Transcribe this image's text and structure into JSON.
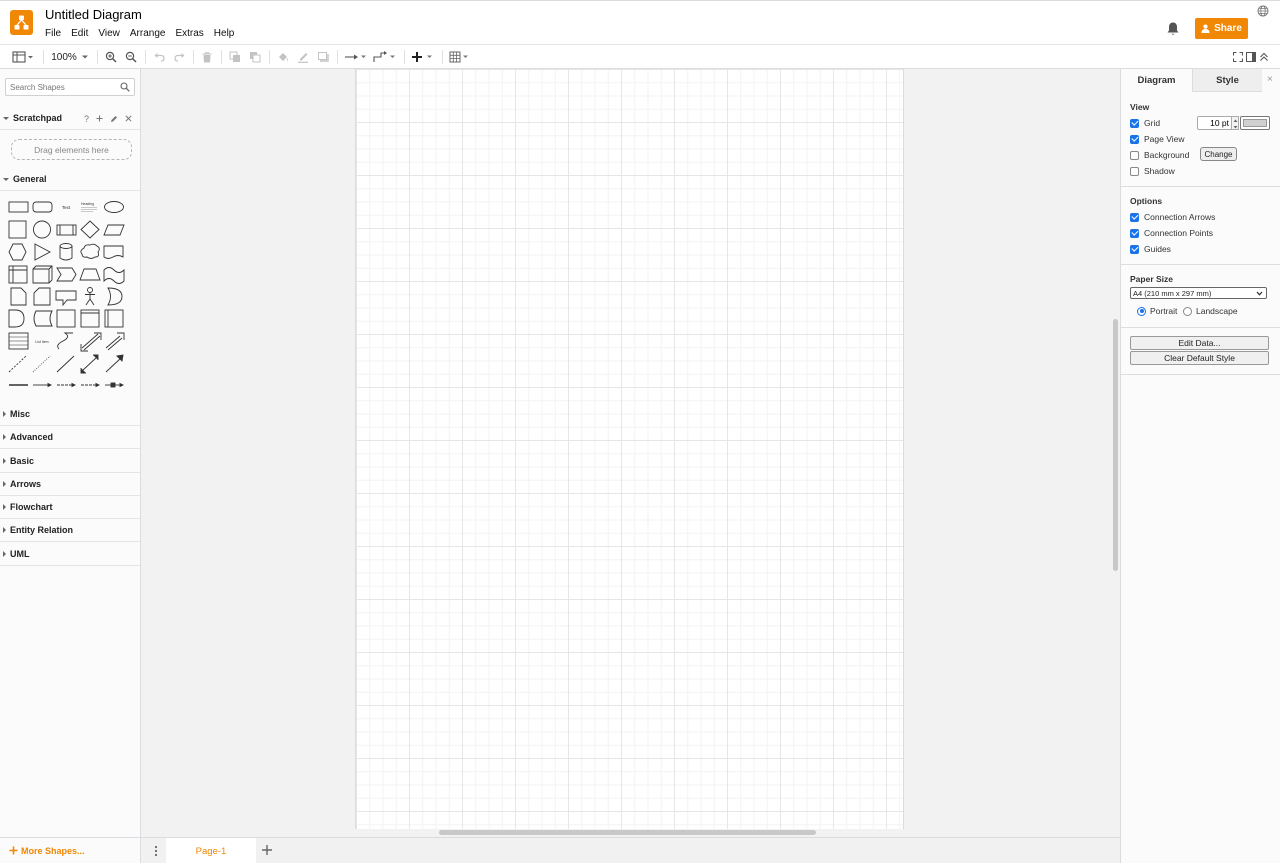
{
  "app": {
    "title": "Untitled Diagram",
    "accent_color": "#f08705",
    "menu": [
      "File",
      "Edit",
      "View",
      "Arrange",
      "Extras",
      "Help"
    ],
    "share_label": "Share"
  },
  "toolbar": {
    "zoom": "100%"
  },
  "sidebar": {
    "search_placeholder": "Search Shapes",
    "scratchpad": {
      "title": "Scratchpad",
      "help": "?",
      "drop_hint": "Drag elements here"
    },
    "general_title": "General",
    "shape_labels": {
      "text": "Text",
      "heading": "Heading",
      "list_item": "List Item"
    },
    "collapsed_sections": [
      "Misc",
      "Advanced",
      "Basic",
      "Arrows",
      "Flowchart",
      "Entity Relation",
      "UML"
    ],
    "more_shapes": "More Shapes..."
  },
  "pages": {
    "current": "Page-1"
  },
  "format_panel": {
    "tabs": [
      "Diagram",
      "Style"
    ],
    "close": "×",
    "view": {
      "title": "View",
      "grid": {
        "label": "Grid",
        "checked": true,
        "size": "10 pt"
      },
      "page_view": {
        "label": "Page View",
        "checked": true
      },
      "background": {
        "label": "Background",
        "checked": false,
        "button": "Change"
      },
      "shadow": {
        "label": "Shadow",
        "checked": false
      }
    },
    "options": {
      "title": "Options",
      "connection_arrows": {
        "label": "Connection Arrows",
        "checked": true
      },
      "connection_points": {
        "label": "Connection Points",
        "checked": true
      },
      "guides": {
        "label": "Guides",
        "checked": true
      }
    },
    "paper": {
      "title": "Paper Size",
      "size": "A4 (210 mm x 297 mm)",
      "portrait": "Portrait",
      "landscape": "Landscape",
      "orientation": "portrait"
    },
    "edit_data": "Edit Data...",
    "clear_style": "Clear Default Style"
  }
}
